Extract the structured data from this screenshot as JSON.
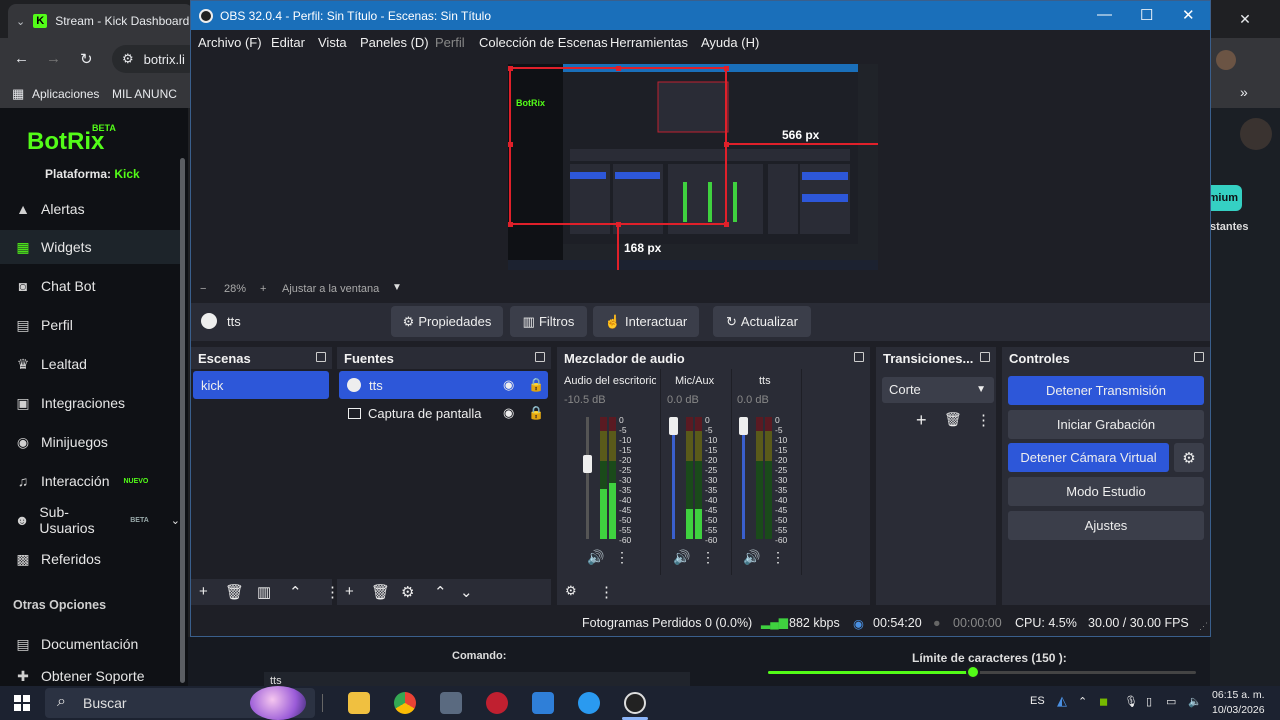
{
  "browser": {
    "tab_title": "Stream - Kick Dashboard",
    "address": "botrix.li",
    "bookmarks": [
      "Aplicaciones",
      "MIL ANUNC"
    ]
  },
  "botrix": {
    "logo": "BotRix",
    "logo_badge": "BETA",
    "platform_label": "Plataforma:",
    "platform_value": "Kick",
    "nav": [
      {
        "label": "Alertas",
        "icon": "alert-icon"
      },
      {
        "label": "Widgets",
        "icon": "widgets-icon"
      },
      {
        "label": "Chat Bot",
        "icon": "robot-icon"
      },
      {
        "label": "Perfil",
        "icon": "profile-icon"
      },
      {
        "label": "Lealtad",
        "icon": "trophy-icon"
      },
      {
        "label": "Integraciones",
        "icon": "integrations-icon"
      },
      {
        "label": "Minijuegos",
        "icon": "gamepad-icon"
      },
      {
        "label": "Interacción",
        "icon": "music-icon",
        "tag": "NUEVO"
      },
      {
        "label": "Sub-Usuarios",
        "icon": "users-icon",
        "tag": "BETA"
      },
      {
        "label": "Referidos",
        "icon": "referral-icon"
      }
    ],
    "section_other": "Otras Opciones",
    "nav_other": [
      {
        "label": "Documentación",
        "icon": "docs-icon"
      },
      {
        "label": "Obtener Soporte",
        "icon": "support-icon"
      }
    ],
    "right_button": "mium",
    "right_text": "stantes",
    "command_label": "Comando:",
    "command_value": "tts",
    "limit_label": "Límite de caracteres (150 ):",
    "limit_value": 150,
    "limit_fraction": 0.48
  },
  "obs": {
    "title": "OBS 32.0.4 - Perfil: Sin Título - Escenas: Sin Título",
    "menu": [
      "Archivo (F)",
      "Editar",
      "Vista",
      "Paneles (D)",
      "Perfil",
      "Colección de Escenas",
      "Herramientas",
      "Ayuda (H)"
    ],
    "preview": {
      "measure_width": "566 px",
      "measure_height": "168 px",
      "mini_logo": "BotRix"
    },
    "zoom": {
      "minus": "−",
      "percent": "28%",
      "plus": "+",
      "fit_label": "Ajustar a la ventana"
    },
    "source_toolbar": {
      "selected_source": "tts",
      "properties": "Propiedades",
      "filters": "Filtros",
      "interact": "Interactuar",
      "refresh": "Actualizar"
    },
    "scenes": {
      "title": "Escenas",
      "items": [
        "kick"
      ]
    },
    "sources": {
      "title": "Fuentes",
      "items": [
        "tts",
        "Captura de pantalla"
      ]
    },
    "mixer": {
      "title": "Mezclador de audio",
      "channels": [
        {
          "name": "Audio del escritorio",
          "db": "-10.5 dB"
        },
        {
          "name": "Mic/Aux",
          "db": "0.0 dB"
        },
        {
          "name": "tts",
          "db": "0.0 dB"
        }
      ],
      "ticks": [
        "0",
        "-5",
        "-10",
        "-15",
        "-20",
        "-25",
        "-30",
        "-35",
        "-40",
        "-45",
        "-50",
        "-55",
        "-60"
      ]
    },
    "transitions": {
      "title": "Transiciones...",
      "selected": "Corte"
    },
    "controls": {
      "title": "Controles",
      "stop_stream": "Detener Transmisión",
      "start_record": "Iniciar Grabación",
      "stop_vcam": "Detener Cámara Virtual",
      "studio_mode": "Modo Estudio",
      "settings": "Ajustes"
    },
    "status": {
      "dropped": "Fotogramas Perdidos 0 (0.0%)",
      "bitrate": "882 kbps",
      "stream_time": "00:54:20",
      "rec_time": "00:00:00",
      "cpu": "CPU: 4.5%",
      "fps": "30.00 / 30.00 FPS"
    }
  },
  "taskbar": {
    "search": "Buscar",
    "lang": "ES",
    "time": "06:15 a. m.",
    "date": "10/03/2026"
  }
}
